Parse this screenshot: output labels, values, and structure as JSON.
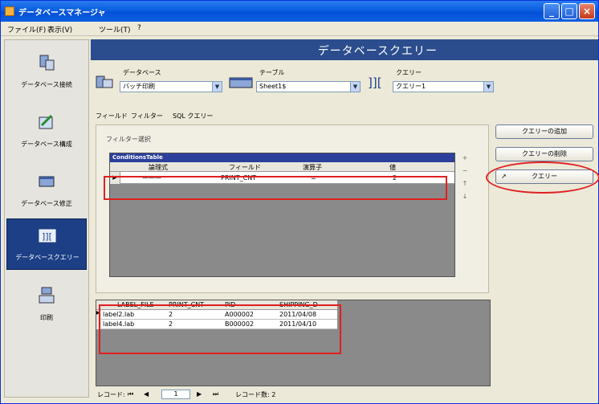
{
  "window": {
    "title": "データベースマネージャ"
  },
  "menu": [
    "ファイル(F)",
    "表示(V)",
    "ツール(T)",
    "?"
  ],
  "nav": [
    {
      "label": "データベース接続",
      "icon": "database-connect-icon"
    },
    {
      "label": "データベース構成",
      "icon": "database-structure-icon"
    },
    {
      "label": "データベース修正",
      "icon": "database-edit-icon"
    },
    {
      "label": "データベースクエリー",
      "icon": "database-query-icon",
      "active": true
    },
    {
      "label": "印刷",
      "icon": "print-icon"
    }
  ],
  "header": {
    "title": "データベースクエリー"
  },
  "selectors": {
    "database_label": "データベース",
    "database_value": "バッチ印刷",
    "table_label": "テーブル",
    "table_value": "Sheet1$",
    "query_label": "クエリー",
    "query_value": "クエリー1"
  },
  "tabs": [
    "フィールド",
    "フィルター",
    "SQL クエリー"
  ],
  "filter": {
    "panel_label": "フィルター選択",
    "grid_title": "ConditionsTable",
    "columns": [
      "論理式",
      "フィールド",
      "演算子",
      "値"
    ],
    "row": {
      "logic": "———",
      "field": "PRINT_CNT",
      "op": "=",
      "value": "2"
    }
  },
  "buttons": {
    "add_query": "クエリーの追加",
    "delete_query": "クエリーの削除",
    "run_query": "クエリー"
  },
  "results": {
    "columns": [
      "LABEL_FILE",
      "PRINT_CNT",
      "PID",
      "SHIPPING_D"
    ],
    "rows": [
      [
        "label2.lab",
        "2",
        "A000002",
        "2011/04/08"
      ],
      [
        "label4.lab",
        "2",
        "B000002",
        "2011/04/10"
      ]
    ]
  },
  "record_nav": {
    "record_label": "レコード:",
    "page": "1",
    "count_label": "レコード数: 2"
  },
  "colors": {
    "banner": "#2b4d8d",
    "grid_title": "#2b3f9b",
    "highlight": "#e02020"
  }
}
